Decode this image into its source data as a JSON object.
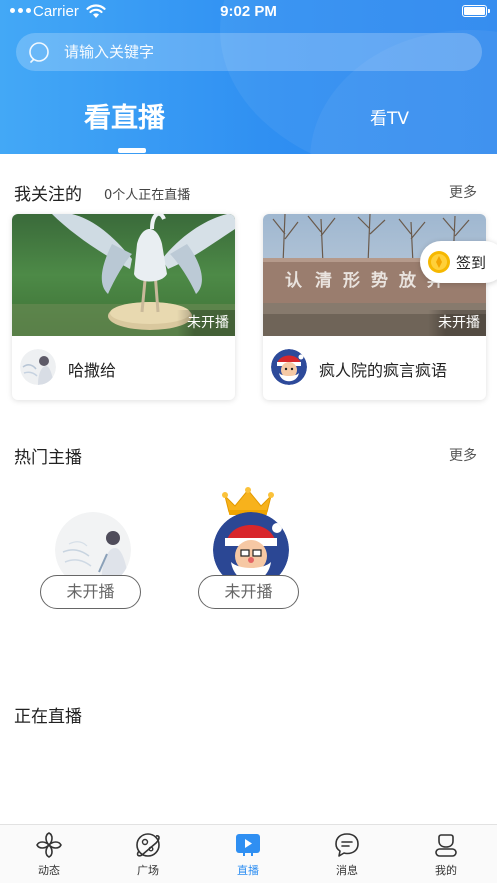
{
  "status_bar": {
    "carrier": "Carrier",
    "time": "9:02 PM"
  },
  "search": {
    "placeholder": "请输入关键字"
  },
  "top_tabs": {
    "live": "看直播",
    "tv": "看TV"
  },
  "following": {
    "title": "我关注的",
    "subtitle": "0个人正在直播",
    "more": "更多",
    "cards": [
      {
        "name": "哈撒给",
        "status": "未开播"
      },
      {
        "name": "疯人院的疯言疯语",
        "status": "未开播"
      }
    ]
  },
  "checkin": {
    "label": "签到"
  },
  "hot_anchors": {
    "title": "热门主播",
    "more": "更多",
    "items": [
      {
        "status": "未开播"
      },
      {
        "status": "未开播"
      }
    ]
  },
  "live_now": {
    "title": "正在直播"
  },
  "tabbar": {
    "items": [
      {
        "label": "动态",
        "icon": "pinwheel-icon"
      },
      {
        "label": "广场",
        "icon": "planet-icon"
      },
      {
        "label": "直播",
        "icon": "live-play-icon"
      },
      {
        "label": "消息",
        "icon": "chat-bubble-icon"
      },
      {
        "label": "我的",
        "icon": "profile-icon"
      }
    ],
    "active_color": "#2f8ff2"
  },
  "colors": {
    "header_blue": "#3596f3",
    "accent": "#2f8ff2"
  }
}
